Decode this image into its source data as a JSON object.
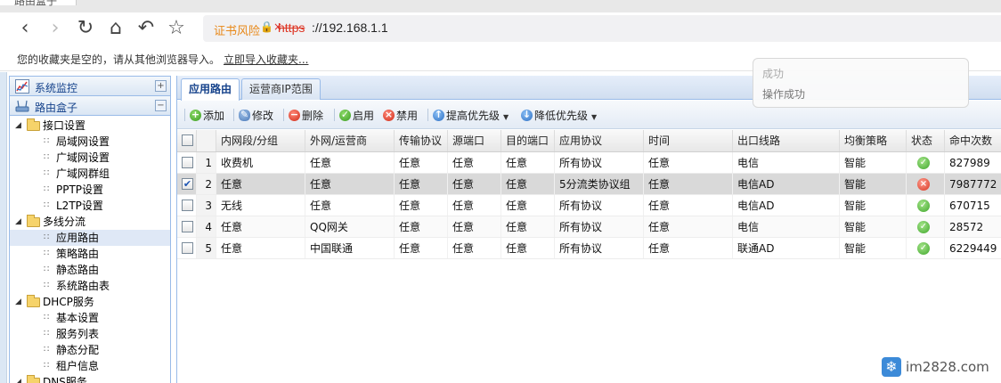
{
  "browser": {
    "tab_title": "路由盒子",
    "security_warning": "证书风险",
    "url_scheme": "https",
    "url_rest": "://192.168.1.1",
    "bookmarks_message": "您的收藏夹是空的，请从其他浏览器导入。",
    "bookmarks_import_link": "立即导入收藏夹..."
  },
  "sidebar": {
    "panels": [
      {
        "label": "系统监控",
        "tool": "+",
        "icon": "chart-icon"
      },
      {
        "label": "路由盒子",
        "tool": "−",
        "icon": "router-icon"
      }
    ],
    "tree": [
      {
        "label": "接口设置",
        "type": "folder"
      },
      {
        "label": "局域网设置",
        "type": "leaf"
      },
      {
        "label": "广域网设置",
        "type": "leaf"
      },
      {
        "label": "广域网群组",
        "type": "leaf"
      },
      {
        "label": "PPTP设置",
        "type": "leaf"
      },
      {
        "label": "L2TP设置",
        "type": "leaf"
      },
      {
        "label": "多线分流",
        "type": "folder"
      },
      {
        "label": "应用路由",
        "type": "leaf",
        "selected": true
      },
      {
        "label": "策略路由",
        "type": "leaf"
      },
      {
        "label": "静态路由",
        "type": "leaf"
      },
      {
        "label": "系统路由表",
        "type": "leaf"
      },
      {
        "label": "DHCP服务",
        "type": "folder"
      },
      {
        "label": "基本设置",
        "type": "leaf"
      },
      {
        "label": "服务列表",
        "type": "leaf"
      },
      {
        "label": "静态分配",
        "type": "leaf"
      },
      {
        "label": "租户信息",
        "type": "leaf"
      },
      {
        "label": "DNS服务",
        "type": "folder"
      }
    ]
  },
  "tabs": [
    {
      "label": "应用路由",
      "active": true
    },
    {
      "label": "运营商IP范围",
      "active": false
    }
  ],
  "actions": {
    "add": "添加",
    "edit": "修改",
    "delete": "删除",
    "enable": "启用",
    "disable": "禁用",
    "raise_priority": "提高优先级",
    "lower_priority": "降低优先级"
  },
  "grid": {
    "columns": [
      "内网段/分组",
      "外网/运营商",
      "传输协议",
      "源端口",
      "目的端口",
      "应用协议",
      "时间",
      "出口线路",
      "均衡策略",
      "状态",
      "命中次数"
    ],
    "rows": [
      {
        "n": "1",
        "checked": false,
        "cells": [
          "收费机",
          "任意",
          "任意",
          "任意",
          "任意",
          "所有协议",
          "任意",
          "电信",
          "智能"
        ],
        "status": "ok",
        "hits": "827989"
      },
      {
        "n": "2",
        "checked": true,
        "cells": [
          "任意",
          "任意",
          "任意",
          "任意",
          "任意",
          "5分流类协议组",
          "任意",
          "电信AD",
          "智能"
        ],
        "status": "bad",
        "hits": "7987772"
      },
      {
        "n": "3",
        "checked": false,
        "cells": [
          "无线",
          "任意",
          "任意",
          "任意",
          "任意",
          "所有协议",
          "任意",
          "电信AD",
          "智能"
        ],
        "status": "ok",
        "hits": "670715"
      },
      {
        "n": "4",
        "checked": false,
        "cells": [
          "任意",
          "QQ网关",
          "任意",
          "任意",
          "任意",
          "所有协议",
          "任意",
          "电信",
          "智能"
        ],
        "status": "ok",
        "hits": "28572"
      },
      {
        "n": "5",
        "checked": false,
        "cells": [
          "任意",
          "中国联通",
          "任意",
          "任意",
          "任意",
          "所有协议",
          "任意",
          "联通AD",
          "智能"
        ],
        "status": "ok",
        "hits": "6229449"
      }
    ]
  },
  "toast": {
    "line1": "成功",
    "line2": "操作成功"
  },
  "watermark": "im2828.com"
}
